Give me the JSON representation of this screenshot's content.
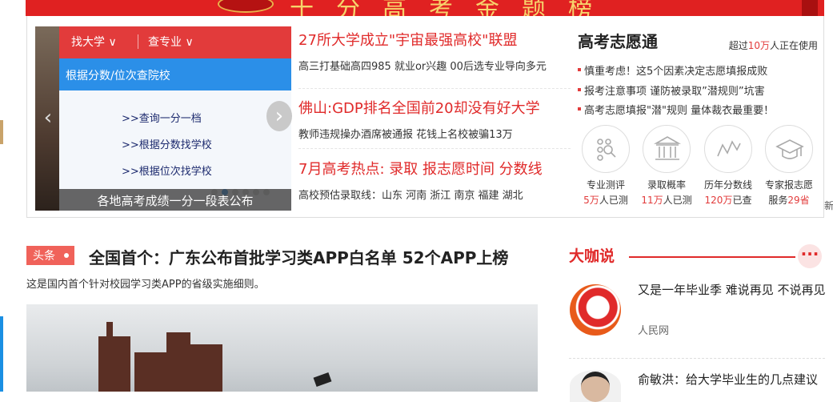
{
  "banner": {
    "text": "十分高考金题榜"
  },
  "slider": {
    "tabs": [
      "找大学 ∨",
      "查专业 ∨"
    ],
    "query_label": "根据分数/位次查院校",
    "links": [
      ">>查询一分一档",
      ">>根据分数找学校",
      ">>根据位次找学校"
    ],
    "caption": "各地高考成绩一分一段表公布",
    "prev": "‹",
    "next": "›"
  },
  "news": [
    {
      "headline": "27所大学成立\"宇宙最强高校\"联盟",
      "sub": "高三打基础高四985 就业or兴趣 00后选专业导向多元"
    },
    {
      "headline": "佛山:GDP排名全国前20却没有好大学",
      "sub": "教师违规操办酒席被通报 花钱上名校被骗13万"
    },
    {
      "headline": "7月高考热点: 录取 报志愿时间 分数线",
      "sub": "高校预估录取线：山东 河南 浙江 南京 福建 湖北"
    }
  ],
  "gaokao": {
    "title": "高考志愿通",
    "count_prefix": "超过",
    "count_value": "10万",
    "count_suffix": "人正在使用",
    "bullets": [
      "慎重考虑！这5个因素决定志愿填报成败",
      "报考注意事项 谨防被录取”潜规则”坑害",
      "高考志愿填报\"潜\"规则 量体裁衣最重要！"
    ],
    "services": [
      {
        "label": "专业测评",
        "count": "5万",
        "suffix": "人已测",
        "icon": "evaluation-icon"
      },
      {
        "label": "录取概率",
        "count": "11万",
        "suffix": "人已测",
        "icon": "university-icon"
      },
      {
        "label": "历年分数线",
        "count": "120万",
        "suffix": "已查",
        "icon": "trend-line-icon"
      },
      {
        "label": "专家报志愿",
        "count_prefix": "服务",
        "count": "29省",
        "icon": "graduation-cap-icon"
      }
    ]
  },
  "right_cut": "新",
  "headline": {
    "badge": "头条",
    "title": "全国首个：广东公布首批学习类APP白名单 52个APP上榜",
    "sub": "这是国内首个针对校园学习类APP的省级实施细则。"
  },
  "dakashuo": {
    "title": "大咖说",
    "more": "···",
    "items": [
      {
        "title": "又是一年毕业季 难说再见 不说再见",
        "source": "人民网"
      },
      {
        "title": "俞敏洪：给大学毕业生的几点建议"
      }
    ]
  }
}
